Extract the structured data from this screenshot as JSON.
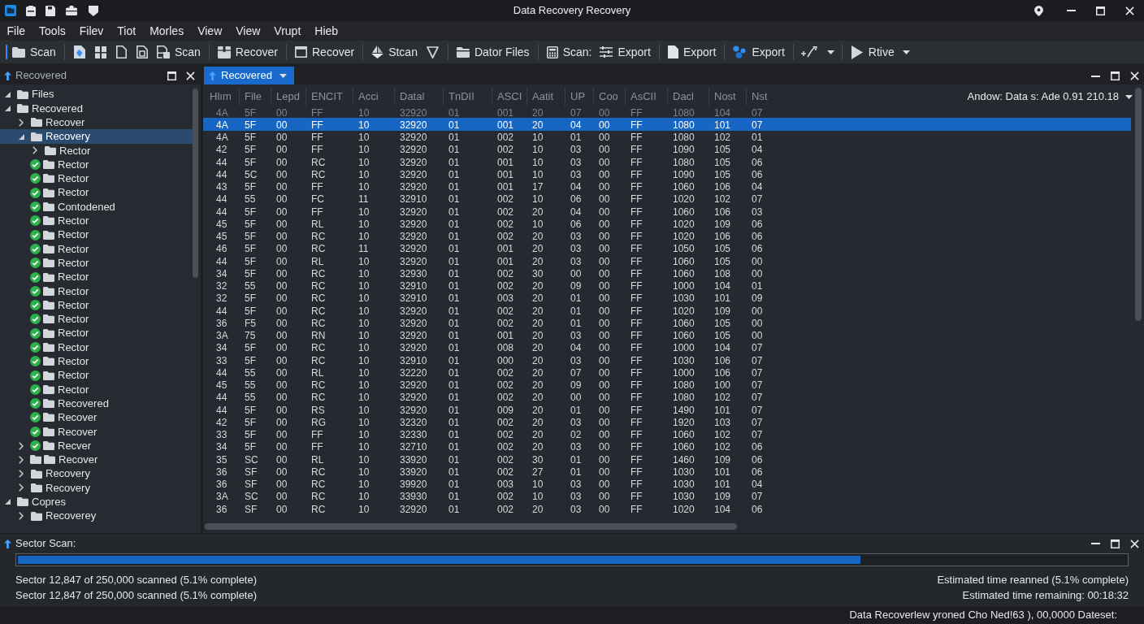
{
  "window": {
    "title": "Data Recovery Recovery"
  },
  "menu": [
    "File",
    "Tools",
    "Filev",
    "Tiot",
    "Morles",
    "View",
    "View",
    "Vrupt",
    "Hieb"
  ],
  "toolbar": [
    [
      {
        "kind": "button",
        "label": "Scan"
      }
    ],
    [
      {
        "kind": "icon"
      },
      {
        "kind": "icon"
      },
      {
        "kind": "icon"
      },
      {
        "kind": "icon"
      },
      {
        "kind": "button",
        "label": "Scan"
      }
    ],
    [
      {
        "kind": "button",
        "label": "Recover"
      }
    ],
    [
      {
        "kind": "button",
        "label": "Recover"
      }
    ],
    [
      {
        "kind": "button",
        "label": "Stcan"
      },
      {
        "kind": "icon"
      }
    ],
    [
      {
        "kind": "button",
        "label": "Dator Files"
      }
    ],
    [
      {
        "kind": "button",
        "label": "Scan:"
      },
      {
        "kind": "button",
        "label": "Export"
      }
    ],
    [
      {
        "kind": "button",
        "label": "Export"
      }
    ],
    [
      {
        "kind": "button",
        "label": "Export"
      }
    ],
    [
      {
        "kind": "split"
      }
    ],
    [
      {
        "kind": "menu",
        "label": "Rtive"
      }
    ]
  ],
  "tree_panel": {
    "title": "Recovered",
    "items": [
      {
        "label": "Files",
        "kind": "branch",
        "expanded": true,
        "checked": false,
        "selected": false
      },
      {
        "label": "Recovered",
        "kind": "branch",
        "expanded": true,
        "checked": false,
        "selected": false,
        "children": [
          {
            "label": "Recover",
            "kind": "branch",
            "expanded": false,
            "checked": false,
            "selected": false
          },
          {
            "label": "Recovery",
            "kind": "branch",
            "expanded": true,
            "checked": false,
            "selected": true,
            "children": [
              {
                "label": "Rector",
                "kind": "branch",
                "expanded": false,
                "checked": false,
                "selected": false
              },
              {
                "label": "Rector",
                "kind": "leaf",
                "checked": true,
                "selected": false
              },
              {
                "label": "Rector",
                "kind": "leaf",
                "checked": true,
                "selected": false
              },
              {
                "label": "Rector",
                "kind": "leaf",
                "checked": true,
                "selected": false
              },
              {
                "label": "Contodened",
                "kind": "leaf",
                "checked": true,
                "selected": false
              },
              {
                "label": "Rector",
                "kind": "leaf",
                "checked": true,
                "selected": false
              },
              {
                "label": "Rector",
                "kind": "leaf",
                "checked": true,
                "selected": false
              },
              {
                "label": "Rector",
                "kind": "leaf",
                "checked": true,
                "selected": false
              },
              {
                "label": "Rector",
                "kind": "leaf",
                "checked": true,
                "selected": false
              },
              {
                "label": "Rector",
                "kind": "leaf",
                "checked": true,
                "selected": false
              },
              {
                "label": "Rector",
                "kind": "leaf",
                "checked": true,
                "selected": false
              },
              {
                "label": "Rector",
                "kind": "leaf",
                "checked": true,
                "selected": false
              },
              {
                "label": "Rector",
                "kind": "leaf",
                "checked": true,
                "selected": false
              },
              {
                "label": "Rector",
                "kind": "leaf",
                "checked": true,
                "selected": false
              },
              {
                "label": "Rector",
                "kind": "leaf",
                "checked": true,
                "selected": false
              },
              {
                "label": "Rector",
                "kind": "leaf",
                "checked": true,
                "selected": false
              },
              {
                "label": "Rector",
                "kind": "leaf",
                "checked": true,
                "selected": false
              },
              {
                "label": "Rector",
                "kind": "leaf",
                "checked": true,
                "selected": false
              },
              {
                "label": "Recovered",
                "kind": "leaf",
                "checked": true,
                "selected": false
              },
              {
                "label": "Recover",
                "kind": "leaf",
                "checked": true,
                "selected": false
              },
              {
                "label": "Recover",
                "kind": "leaf",
                "checked": true,
                "selected": false
              }
            ]
          },
          {
            "label": "Recver",
            "kind": "branch",
            "expanded": false,
            "checked": true,
            "selected": false
          },
          {
            "label": "Recover",
            "kind": "stack",
            "expanded": false,
            "checked": false,
            "selected": false
          },
          {
            "label": "Recovery",
            "kind": "branch",
            "expanded": false,
            "checked": false,
            "selected": false
          },
          {
            "label": "Recovery",
            "kind": "branch",
            "expanded": false,
            "checked": false,
            "selected": false
          }
        ]
      },
      {
        "label": "Copres",
        "kind": "branch",
        "expanded": true,
        "checked": false,
        "selected": false,
        "children": [
          {
            "label": "Recoverey",
            "kind": "branch",
            "expanded": false,
            "checked": false,
            "selected": false
          }
        ]
      }
    ]
  },
  "table_panel": {
    "tabs": [
      {
        "label": "Recovered",
        "selected": true
      }
    ],
    "source": "Andow: Data s: Ade 0.91 210.18",
    "columns": [
      "Hlım",
      "File",
      "Lepd",
      "ENCIT",
      "Acci",
      "Datal",
      "TnDII",
      "ASCI",
      "Aatit",
      "UP",
      "Coo",
      "AsCII",
      "Dacl",
      "Nost",
      "Nst"
    ],
    "rows": [
      {
        "cells": [
          "4A",
          "5F",
          "00",
          "FF",
          "10",
          "32920",
          "01",
          "001",
          "20",
          "07",
          "00",
          "FF",
          "1080",
          "104",
          "07"
        ],
        "selected": false,
        "dimmed": true
      },
      {
        "cells": [
          "4A",
          "5F",
          "00",
          "FF",
          "10",
          "32920",
          "01",
          "001",
          "20",
          "04",
          "00",
          "FF",
          "1080",
          "101",
          "07"
        ],
        "selected": true,
        "dimmed": false
      },
      {
        "cells": [
          "4A",
          "5F",
          "00",
          "FF",
          "10",
          "32920",
          "01",
          "002",
          "10",
          "01",
          "00",
          "FF",
          "1080",
          "102",
          "01"
        ],
        "selected": false,
        "dimmed": false
      },
      {
        "cells": [
          "42",
          "5F",
          "00",
          "FF",
          "10",
          "32920",
          "01",
          "002",
          "10",
          "03",
          "00",
          "FF",
          "1090",
          "105",
          "04"
        ],
        "selected": false,
        "dimmed": false
      },
      {
        "cells": [
          "44",
          "5F",
          "00",
          "RC",
          "10",
          "32920",
          "01",
          "001",
          "10",
          "03",
          "00",
          "FF",
          "1080",
          "105",
          "06"
        ],
        "selected": false,
        "dimmed": false
      },
      {
        "cells": [
          "44",
          "5C",
          "00",
          "RC",
          "10",
          "32920",
          "01",
          "001",
          "10",
          "03",
          "00",
          "FF",
          "1090",
          "105",
          "06"
        ],
        "selected": false,
        "dimmed": false
      },
      {
        "cells": [
          "43",
          "5F",
          "00",
          "FF",
          "10",
          "32920",
          "01",
          "001",
          "17",
          "04",
          "00",
          "FF",
          "1060",
          "106",
          "04"
        ],
        "selected": false,
        "dimmed": false
      },
      {
        "cells": [
          "44",
          "55",
          "00",
          "FC",
          "11",
          "32910",
          "01",
          "002",
          "10",
          "06",
          "00",
          "FF",
          "1020",
          "102",
          "07"
        ],
        "selected": false,
        "dimmed": false
      },
      {
        "cells": [
          "44",
          "5F",
          "00",
          "FF",
          "10",
          "32920",
          "01",
          "002",
          "20",
          "04",
          "00",
          "FF",
          "1060",
          "106",
          "03"
        ],
        "selected": false,
        "dimmed": false
      },
      {
        "cells": [
          "45",
          "5F",
          "00",
          "RL",
          "10",
          "32920",
          "01",
          "002",
          "10",
          "06",
          "00",
          "FF",
          "1020",
          "109",
          "06"
        ],
        "selected": false,
        "dimmed": false
      },
      {
        "cells": [
          "45",
          "5F",
          "00",
          "RC",
          "10",
          "32920",
          "01",
          "002",
          "20",
          "03",
          "00",
          "FF",
          "1020",
          "106",
          "06"
        ],
        "selected": false,
        "dimmed": false
      },
      {
        "cells": [
          "46",
          "5F",
          "00",
          "RC",
          "11",
          "32920",
          "01",
          "001",
          "20",
          "03",
          "00",
          "FF",
          "1050",
          "105",
          "06"
        ],
        "selected": false,
        "dimmed": false
      },
      {
        "cells": [
          "44",
          "5F",
          "00",
          "RL",
          "10",
          "32920",
          "01",
          "001",
          "20",
          "03",
          "00",
          "FF",
          "1060",
          "105",
          "00"
        ],
        "selected": false,
        "dimmed": false
      },
      {
        "cells": [
          "34",
          "5F",
          "00",
          "RC",
          "10",
          "32930",
          "01",
          "002",
          "30",
          "00",
          "00",
          "FF",
          "1060",
          "108",
          "00"
        ],
        "selected": false,
        "dimmed": false
      },
      {
        "cells": [
          "32",
          "55",
          "00",
          "RC",
          "10",
          "32910",
          "01",
          "002",
          "20",
          "09",
          "00",
          "FF",
          "1000",
          "104",
          "01"
        ],
        "selected": false,
        "dimmed": false
      },
      {
        "cells": [
          "32",
          "5F",
          "00",
          "RC",
          "10",
          "32910",
          "01",
          "003",
          "20",
          "01",
          "00",
          "FF",
          "1030",
          "101",
          "09"
        ],
        "selected": false,
        "dimmed": false
      },
      {
        "cells": [
          "44",
          "5F",
          "00",
          "RC",
          "10",
          "32920",
          "01",
          "002",
          "20",
          "01",
          "00",
          "FF",
          "1020",
          "109",
          "00"
        ],
        "selected": false,
        "dimmed": false
      },
      {
        "cells": [
          "36",
          "F5",
          "00",
          "RC",
          "10",
          "32920",
          "01",
          "002",
          "20",
          "01",
          "00",
          "FF",
          "1060",
          "105",
          "00"
        ],
        "selected": false,
        "dimmed": false
      },
      {
        "cells": [
          "3A",
          "75",
          "00",
          "RN",
          "10",
          "32920",
          "01",
          "001",
          "20",
          "03",
          "00",
          "FF",
          "1060",
          "105",
          "00"
        ],
        "selected": false,
        "dimmed": false
      },
      {
        "cells": [
          "34",
          "5F",
          "00",
          "RC",
          "10",
          "32920",
          "01",
          "008",
          "20",
          "04",
          "00",
          "FF",
          "1000",
          "104",
          "07"
        ],
        "selected": false,
        "dimmed": false
      },
      {
        "cells": [
          "33",
          "5F",
          "00",
          "RC",
          "10",
          "32910",
          "01",
          "000",
          "20",
          "03",
          "00",
          "FF",
          "1030",
          "106",
          "07"
        ],
        "selected": false,
        "dimmed": false
      },
      {
        "cells": [
          "44",
          "55",
          "00",
          "RL",
          "10",
          "32220",
          "01",
          "002",
          "20",
          "07",
          "00",
          "FF",
          "1000",
          "106",
          "07"
        ],
        "selected": false,
        "dimmed": false
      },
      {
        "cells": [
          "45",
          "55",
          "00",
          "RC",
          "10",
          "32920",
          "01",
          "002",
          "20",
          "09",
          "00",
          "FF",
          "1080",
          "100",
          "07"
        ],
        "selected": false,
        "dimmed": false
      },
      {
        "cells": [
          "44",
          "55",
          "00",
          "RC",
          "10",
          "32920",
          "01",
          "002",
          "20",
          "00",
          "00",
          "FF",
          "1080",
          "102",
          "07"
        ],
        "selected": false,
        "dimmed": false
      },
      {
        "cells": [
          "44",
          "5F",
          "00",
          "RS",
          "10",
          "32920",
          "01",
          "009",
          "20",
          "01",
          "00",
          "FF",
          "1490",
          "101",
          "07"
        ],
        "selected": false,
        "dimmed": false
      },
      {
        "cells": [
          "42",
          "5F",
          "00",
          "RG",
          "10",
          "32320",
          "01",
          "002",
          "20",
          "03",
          "00",
          "FF",
          "1920",
          "103",
          "07"
        ],
        "selected": false,
        "dimmed": false
      },
      {
        "cells": [
          "33",
          "5F",
          "00",
          "FF",
          "10",
          "32330",
          "01",
          "002",
          "20",
          "02",
          "00",
          "FF",
          "1060",
          "102",
          "07"
        ],
        "selected": false,
        "dimmed": false
      },
      {
        "cells": [
          "34",
          "5F",
          "00",
          "FF",
          "10",
          "32710",
          "01",
          "002",
          "20",
          "03",
          "00",
          "FF",
          "1060",
          "102",
          "06"
        ],
        "selected": false,
        "dimmed": false
      },
      {
        "cells": [
          "35",
          "SC",
          "00",
          "RL",
          "10",
          "33920",
          "01",
          "002",
          "30",
          "01",
          "00",
          "FF",
          "1460",
          "109",
          "06"
        ],
        "selected": false,
        "dimmed": false
      },
      {
        "cells": [
          "36",
          "SF",
          "00",
          "RC",
          "10",
          "33920",
          "01",
          "002",
          "27",
          "01",
          "00",
          "FF",
          "1030",
          "101",
          "06"
        ],
        "selected": false,
        "dimmed": false
      },
      {
        "cells": [
          "36",
          "SF",
          "00",
          "RC",
          "10",
          "39920",
          "01",
          "003",
          "10",
          "03",
          "00",
          "FF",
          "1030",
          "101",
          "04"
        ],
        "selected": false,
        "dimmed": false
      },
      {
        "cells": [
          "3A",
          "SC",
          "00",
          "RC",
          "10",
          "33930",
          "01",
          "002",
          "10",
          "03",
          "00",
          "FF",
          "1030",
          "109",
          "07"
        ],
        "selected": false,
        "dimmed": false
      },
      {
        "cells": [
          "36",
          "SF",
          "00",
          "RC",
          "10",
          "32920",
          "01",
          "002",
          "20",
          "03",
          "00",
          "FF",
          "1020",
          "104",
          "06"
        ],
        "selected": false,
        "dimmed": false
      }
    ]
  },
  "scan_panel": {
    "title": "Sector Scan:",
    "progress": {
      "level": 0.76
    },
    "status_lines": [
      {
        "left": "Sector 12,847 of 250,000 scanned (5.1% complete)",
        "right": "Estimated time reanned (5.1% complete)"
      },
      {
        "left": "Sector 12,847 of 250,000 scanned (5.1% complete)",
        "right": "Estimated time remaining: 00:18:32"
      }
    ]
  },
  "status_bar": {
    "text": "Data Recoverlew yroned Cho Ned!63 ), 00,0000 Dateset:"
  }
}
